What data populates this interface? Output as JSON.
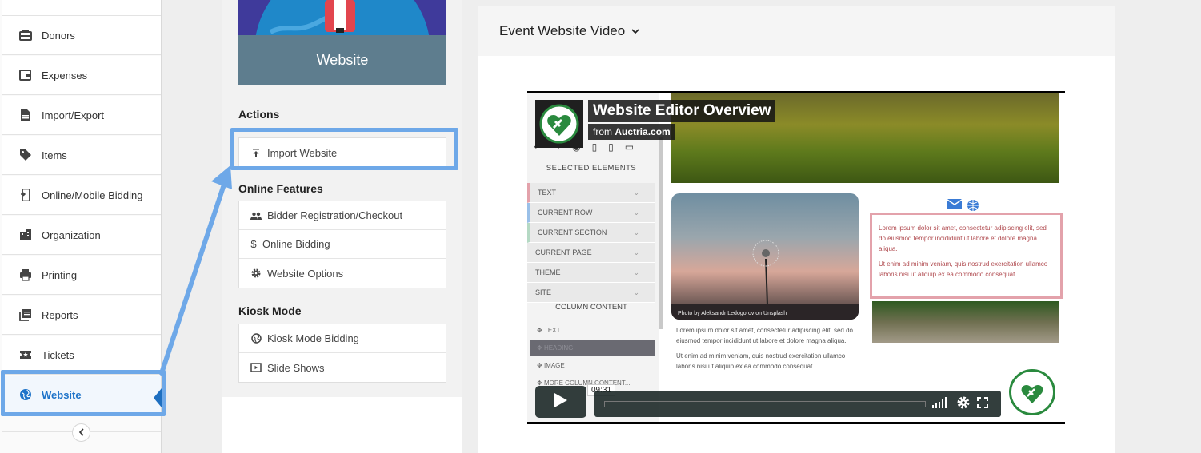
{
  "sidebar": {
    "items": [
      {
        "label": "Donors",
        "icon": "donors-icon"
      },
      {
        "label": "Expenses",
        "icon": "wallet-icon"
      },
      {
        "label": "Import/Export",
        "icon": "document-icon"
      },
      {
        "label": "Items",
        "icon": "tag-icon"
      },
      {
        "label": "Online/Mobile Bidding",
        "icon": "mobile-icon"
      },
      {
        "label": "Organization",
        "icon": "building-icon"
      },
      {
        "label": "Printing",
        "icon": "printer-icon"
      },
      {
        "label": "Reports",
        "icon": "reports-icon"
      },
      {
        "label": "Tickets",
        "icon": "ticket-icon"
      },
      {
        "label": "Website",
        "icon": "globe-icon",
        "active": true
      }
    ],
    "collapse_icon": "chevron-left-icon"
  },
  "hero": {
    "label": "Website"
  },
  "actions": {
    "title": "Actions",
    "items": [
      {
        "label": "Import Website",
        "icon": "upload-icon"
      }
    ]
  },
  "online_features": {
    "title": "Online Features",
    "items": [
      {
        "label": "Bidder Registration/Checkout",
        "icon": "people-icon"
      },
      {
        "label": "Online Bidding",
        "icon": "dollar-icon"
      },
      {
        "label": "Website Options",
        "icon": "gear-icon"
      }
    ]
  },
  "kiosk_mode": {
    "title": "Kiosk Mode",
    "items": [
      {
        "label": "Kiosk Mode Bidding",
        "icon": "globe-icon"
      },
      {
        "label": "Slide Shows",
        "icon": "slideshow-icon"
      }
    ]
  },
  "video_section": {
    "header": "Event Website Video",
    "video": {
      "title": "Website Editor Overview",
      "from_prefix": "from",
      "from_source": "Auctria.com",
      "time_tooltip": "09:31",
      "editor": {
        "selected_elements": "SELECTED ELEMENTS",
        "rows": [
          "TEXT",
          "CURRENT ROW",
          "CURRENT SECTION",
          "CURRENT PAGE",
          "THEME",
          "SITE"
        ],
        "column_content": "COLUMN CONTENT",
        "sub_items": [
          "TEXT",
          "HEADING",
          "IMAGE",
          "MORE COLUMN CONTENT..."
        ]
      },
      "photo_credit": "Photo by Aleksandr Ledogorov on Unsplash",
      "lorem_box": {
        "p1": "Lorem ipsum dolor sit amet, consectetur adipiscing elit, sed do eiusmod tempor incididunt ut labore et dolore magna aliqua.",
        "p2": "Ut enim ad minim veniam, quis nostrud exercitation ullamco laboris nisi ut aliquip ex ea commodo consequat."
      },
      "lorem_under": {
        "p1": "Lorem ipsum dolor sit amet, consectetur adipiscing elit, sed do eiusmod tempor incididunt ut labore et dolore magna aliqua.",
        "p2": "Ut enim ad minim veniam, quis nostrud exercitation ullamco laboris nisi ut aliquip ex ea commodo consequat."
      }
    }
  },
  "colors": {
    "active_blue": "#1e73c9",
    "highlight_outline": "#6ea8e8",
    "hero_bottom": "#5e7d8e"
  }
}
